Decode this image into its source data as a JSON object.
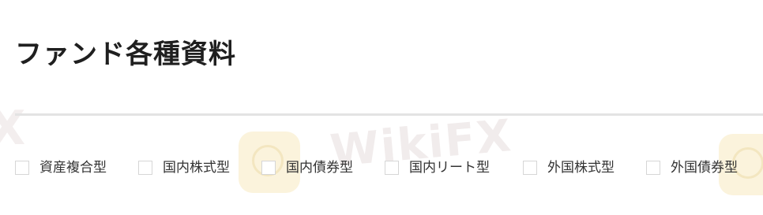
{
  "page": {
    "title": "ファンド各種資料"
  },
  "filters": [
    {
      "label": "資産複合型",
      "checked": false
    },
    {
      "label": "国内株式型",
      "checked": false
    },
    {
      "label": "国内債券型",
      "checked": false
    },
    {
      "label": "国内リート型",
      "checked": false
    },
    {
      "label": "外国株式型",
      "checked": false
    },
    {
      "label": "外国債券型",
      "checked": false
    }
  ],
  "watermark": {
    "text": "WikiFX"
  },
  "colors": {
    "text": "#222222",
    "divider": "#e3e3e3",
    "checkbox_border": "#d6d6d6",
    "watermark_logo": "#fbf3dc"
  }
}
